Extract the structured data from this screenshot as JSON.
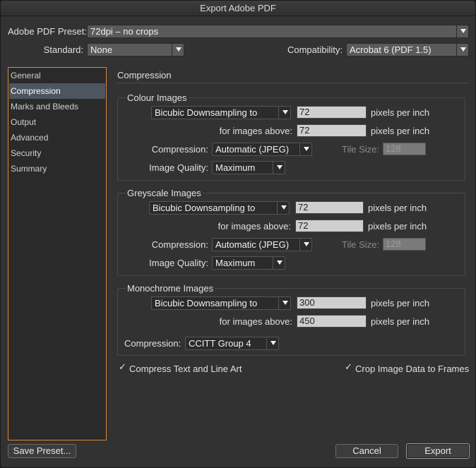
{
  "window": {
    "title": "Export Adobe PDF"
  },
  "preset": {
    "label": "Adobe PDF Preset:",
    "value": "72dpi – no crops"
  },
  "standard": {
    "label": "Standard:",
    "value": "None"
  },
  "compatibility": {
    "label": "Compatibility:",
    "value": "Acrobat 6 (PDF 1.5)"
  },
  "sidebar": {
    "items": [
      {
        "label": "General"
      },
      {
        "label": "Compression"
      },
      {
        "label": "Marks and Bleeds"
      },
      {
        "label": "Output"
      },
      {
        "label": "Advanced"
      },
      {
        "label": "Security"
      },
      {
        "label": "Summary"
      }
    ],
    "active_index": 1
  },
  "section_title": "Compression",
  "colour": {
    "title": "Colour Images",
    "downsample": "Bicubic Downsampling to",
    "ppi": "72",
    "ppi_unit": "pixels per inch",
    "above_label": "for images above:",
    "above": "72",
    "above_unit": "pixels per inch",
    "compression_label": "Compression:",
    "compression": "Automatic (JPEG)",
    "tile_label": "Tile Size:",
    "tile": "128",
    "quality_label": "Image Quality:",
    "quality": "Maximum"
  },
  "greyscale": {
    "title": "Greyscale Images",
    "downsample": "Bicubic Downsampling to",
    "ppi": "72",
    "ppi_unit": "pixels per inch",
    "above_label": "for images above:",
    "above": "72",
    "above_unit": "pixels per inch",
    "compression_label": "Compression:",
    "compression": "Automatic (JPEG)",
    "tile_label": "Tile Size:",
    "tile": "128",
    "quality_label": "Image Quality:",
    "quality": "Maximum"
  },
  "mono": {
    "title": "Monochrome Images",
    "downsample": "Bicubic Downsampling to",
    "ppi": "300",
    "ppi_unit": "pixels per inch",
    "above_label": "for images above:",
    "above": "450",
    "above_unit": "pixels per inch",
    "compression_label": "Compression:",
    "compression": "CCITT Group 4"
  },
  "options": {
    "compress_text": {
      "label": "Compress Text and Line Art",
      "checked": true
    },
    "crop_image": {
      "label": "Crop Image Data to Frames",
      "checked": true
    },
    "check_glyph": "✓"
  },
  "buttons": {
    "save_preset": "Save Preset...",
    "cancel": "Cancel",
    "export": "Export"
  }
}
